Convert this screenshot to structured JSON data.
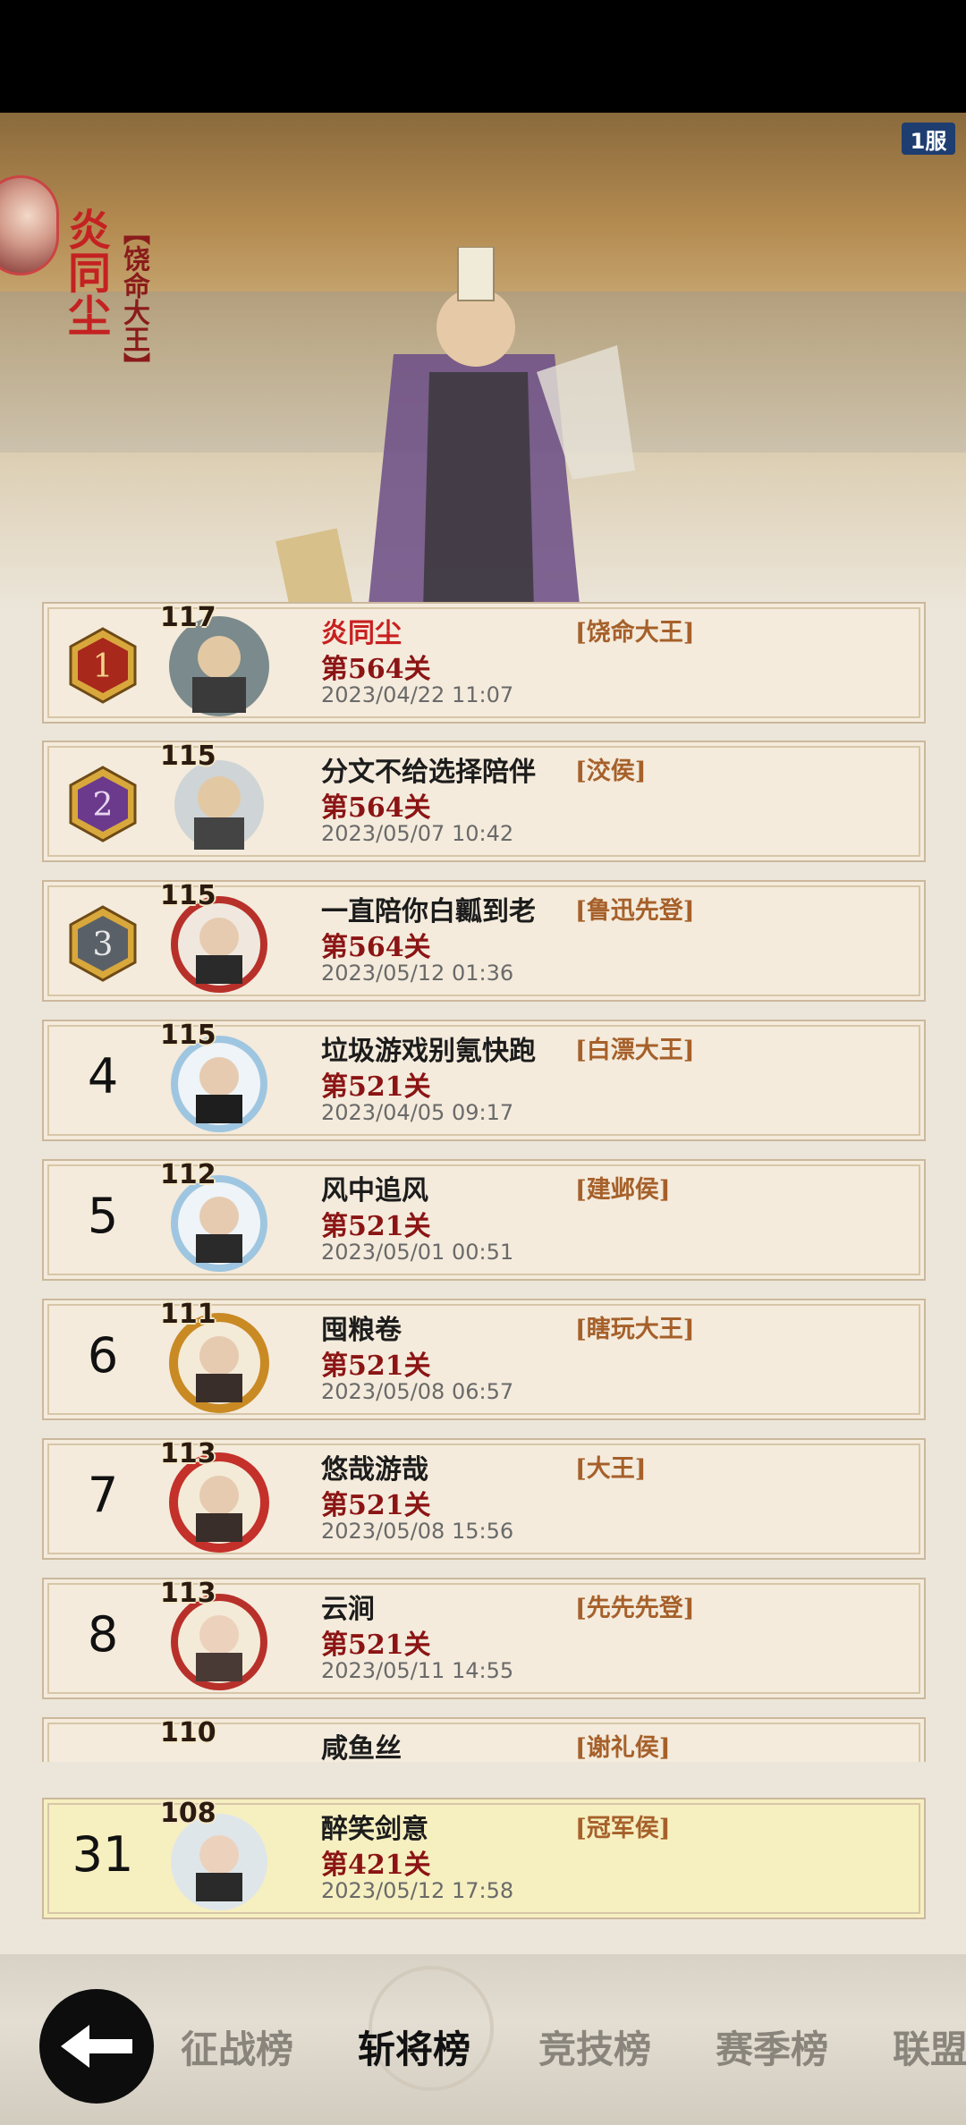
{
  "server": {
    "badge": "1服"
  },
  "top": {
    "name": "炎同尘",
    "title": "【饶命大王】"
  },
  "rows": [
    {
      "rank": 1,
      "level": "117",
      "name": "炎同尘",
      "title": "[饶命大王]",
      "stage": "第564关",
      "date": "2023/04/22 11:07"
    },
    {
      "rank": 2,
      "level": "115",
      "name": "分文不给选择陪伴",
      "title": "[洨侯]",
      "stage": "第564关",
      "date": "2023/05/07 10:42"
    },
    {
      "rank": 3,
      "level": "115",
      "name": "一直陪你白瓤到老",
      "title": "[鲁迅先登]",
      "stage": "第564关",
      "date": "2023/05/12 01:36"
    },
    {
      "rank": "4",
      "level": "115",
      "name": "垃圾游戏别氪快跑",
      "title": "[白漂大王]",
      "stage": "第521关",
      "date": "2023/04/05 09:17"
    },
    {
      "rank": "5",
      "level": "112",
      "name": "风中追风",
      "title": "[建邺侯]",
      "stage": "第521关",
      "date": "2023/05/01 00:51"
    },
    {
      "rank": "6",
      "level": "111",
      "name": "囤粮卷",
      "title": "[瞎玩大王]",
      "stage": "第521关",
      "date": "2023/05/08 06:57"
    },
    {
      "rank": "7",
      "level": "113",
      "name": "悠哉游哉",
      "title": "[大王]",
      "stage": "第521关",
      "date": "2023/05/08 15:56"
    },
    {
      "rank": "8",
      "level": "113",
      "name": "云涧",
      "title": "[先先先登]",
      "stage": "第521关",
      "date": "2023/05/11 14:55"
    },
    {
      "rank": "",
      "level": "110",
      "name": "咸鱼丝",
      "title": "[谢礼侯]",
      "stage": "",
      "date": ""
    }
  ],
  "mine": {
    "rank": "31",
    "level": "108",
    "name": "醉笑剑意",
    "title": "[冠军侯]",
    "stage": "第421关",
    "date": "2023/05/12 17:58"
  },
  "tabs": [
    "征战榜",
    "斩将榜",
    "竞技榜",
    "赛季榜",
    "联盟"
  ],
  "colors": {
    "gold": "#d8a83c",
    "purple": "#6b3a8c",
    "slate": "#5a6068",
    "name_red": "#c82020",
    "stage_red": "#8b1414",
    "title_brown": "#a6602a"
  }
}
